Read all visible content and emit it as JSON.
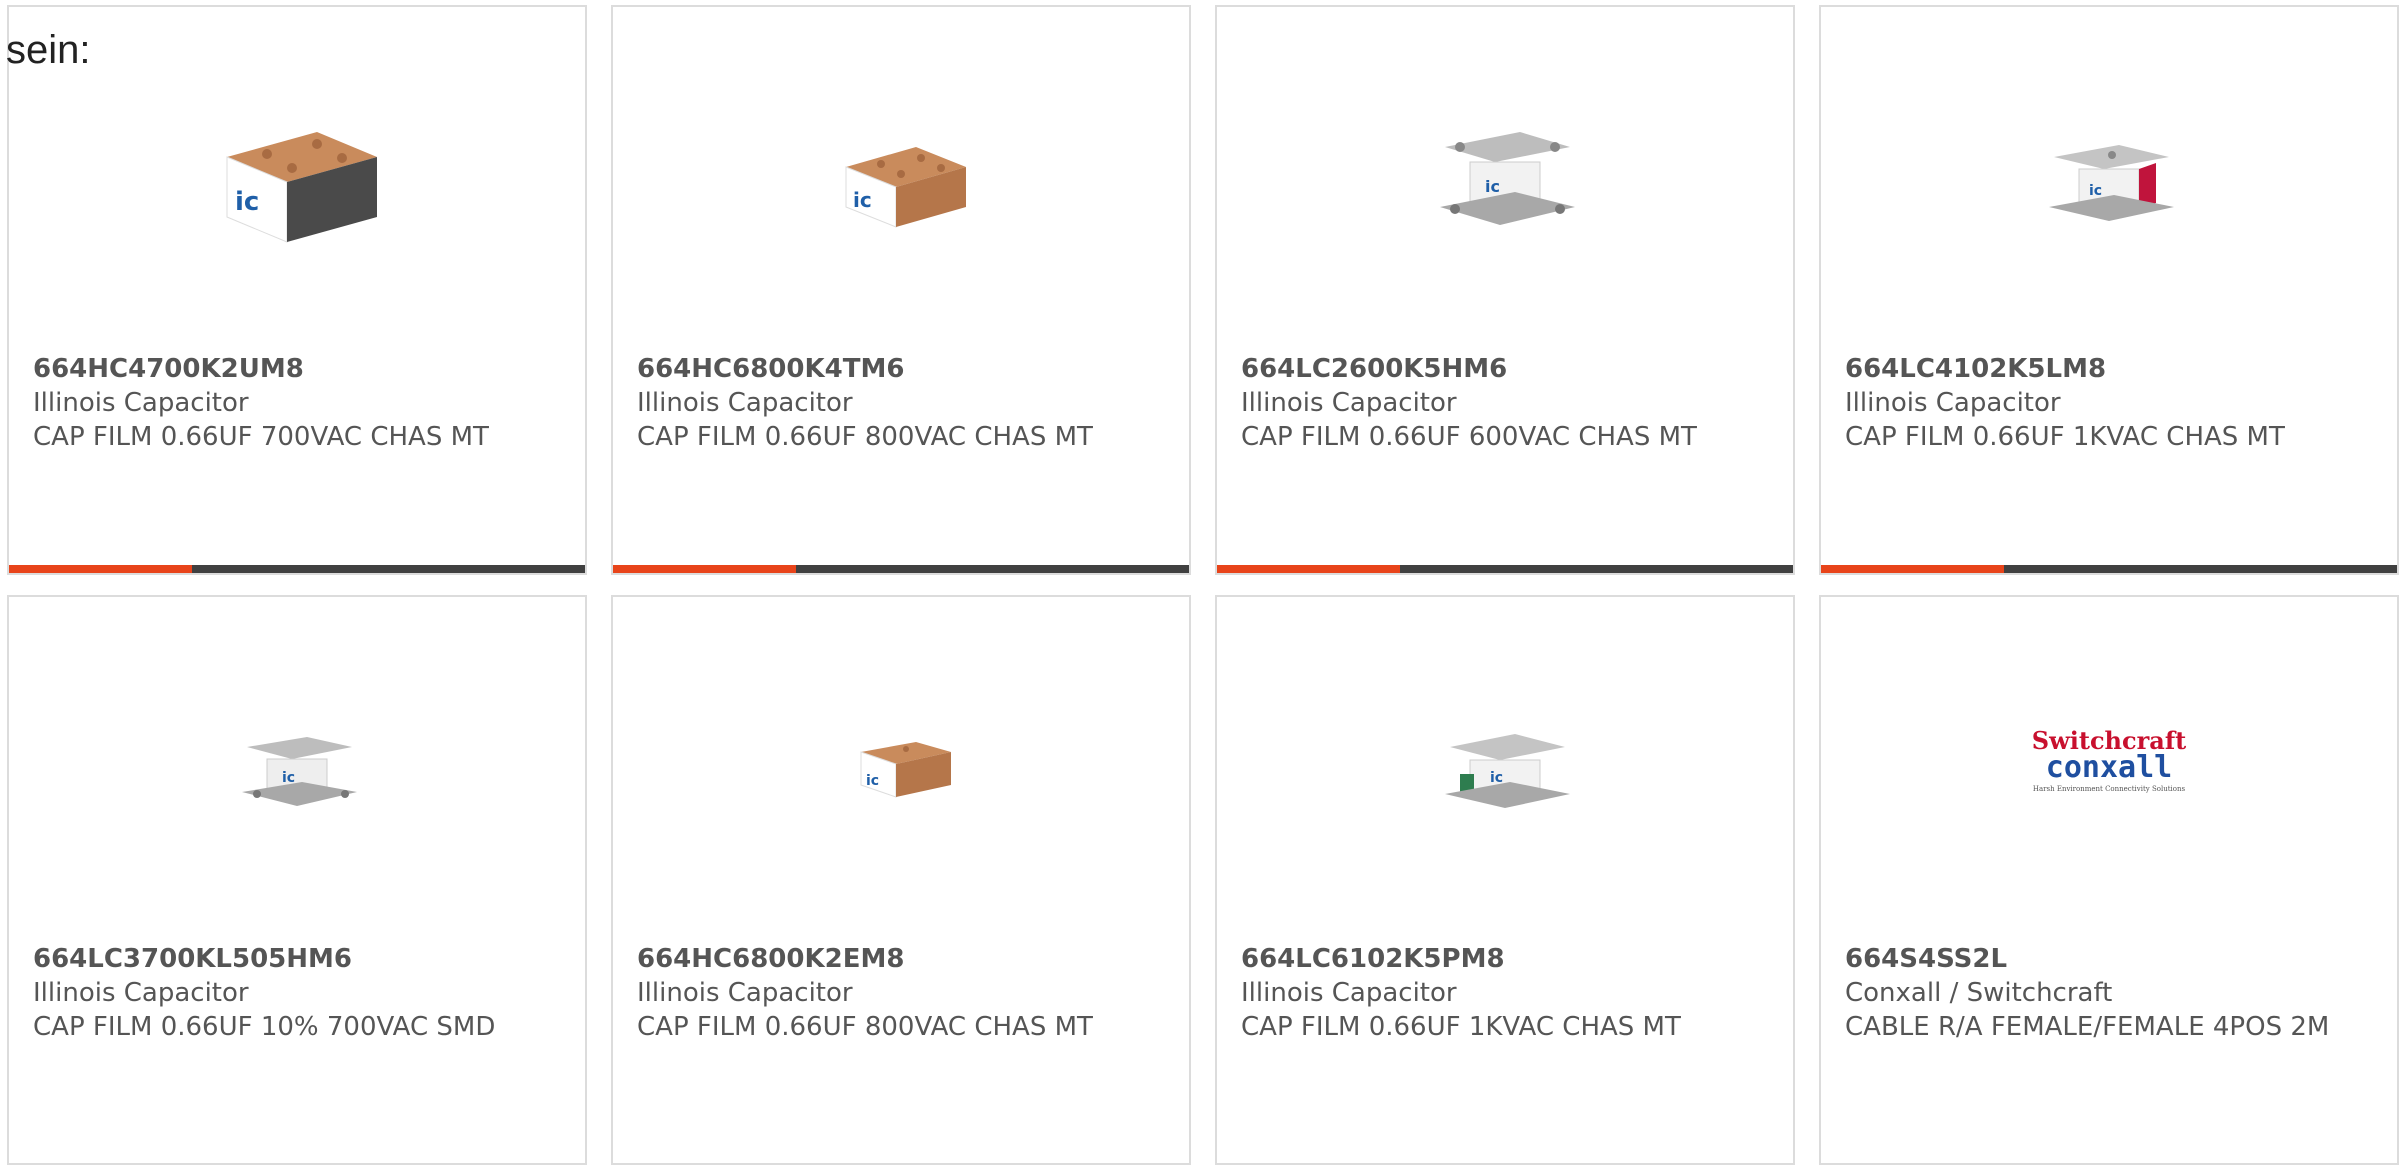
{
  "intro_text": "sein:",
  "colors": {
    "accent": "#e8441a",
    "bar_dark": "#404040",
    "card_border": "#dcdcdc",
    "text": "#555555"
  },
  "products": [
    {
      "part_number": "664HC4700K2UM8",
      "manufacturer": "Illinois Capacitor",
      "description": "CAP FILM 0.66UF 700VAC CHAS MT",
      "image": "copper-box-capacitor"
    },
    {
      "part_number": "664HC6800K4TM6",
      "manufacturer": "Illinois Capacitor",
      "description": "CAP FILM 0.66UF 800VAC CHAS MT",
      "image": "copper-box-capacitor"
    },
    {
      "part_number": "664LC2600K5HM6",
      "manufacturer": "Illinois Capacitor",
      "description": "CAP FILM 0.66UF 600VAC CHAS MT",
      "image": "silver-plate-capacitor"
    },
    {
      "part_number": "664LC4102K5LM8",
      "manufacturer": "Illinois Capacitor",
      "description": "CAP FILM 0.66UF 1KVAC CHAS MT",
      "image": "silver-red-capacitor"
    },
    {
      "part_number": "664LC3700KL505HM6",
      "manufacturer": "Illinois Capacitor",
      "description": "CAP FILM 0.66UF 10% 700VAC SMD",
      "image": "silver-plate-capacitor"
    },
    {
      "part_number": "664HC6800K2EM8",
      "manufacturer": "Illinois Capacitor",
      "description": "CAP FILM 0.66UF 800VAC CHAS MT",
      "image": "copper-box-capacitor"
    },
    {
      "part_number": "664LC6102K5PM8",
      "manufacturer": "Illinois Capacitor",
      "description": "CAP FILM 0.66UF 1KVAC CHAS MT",
      "image": "silver-green-capacitor"
    },
    {
      "part_number": "664S4SS2L",
      "manufacturer": "Conxall / Switchcraft",
      "description": "CABLE R/A FEMALE/FEMALE 4POS 2M",
      "image": "switchcraft-conxall-logo",
      "logo_text": {
        "line1": "Switchcraft",
        "line2": "conxall",
        "tagline": "Harsh Environment Connectivity Solutions"
      }
    }
  ]
}
